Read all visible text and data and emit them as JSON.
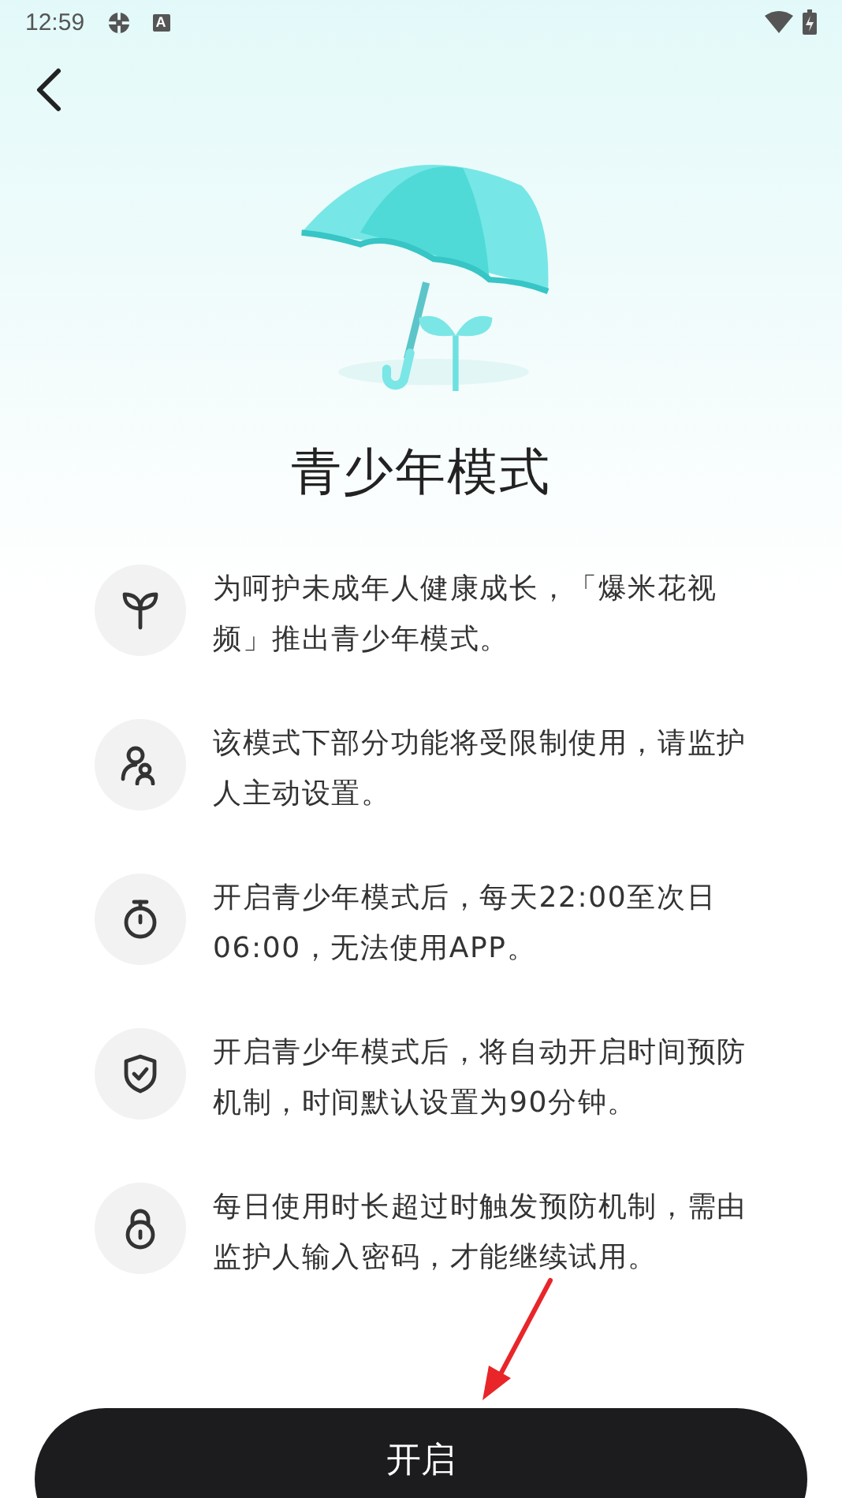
{
  "status_bar": {
    "time": "12:59",
    "app_badge": "A"
  },
  "title": "青少年模式",
  "features": [
    {
      "kind": "sprout",
      "text": "为呵护未成年人健康成长，「爆米花视频」推出青少年模式。"
    },
    {
      "kind": "guardian",
      "text": "该模式下部分功能将受限制使用，请监护人主动设置。"
    },
    {
      "kind": "timer",
      "text": "开启青少年模式后，每天22:00至次日06:00，无法使用APP。"
    },
    {
      "kind": "shield",
      "text": "开启青少年模式后，将自动开启时间预防机制，时间默认设置为90分钟。"
    },
    {
      "kind": "lock",
      "text": "每日使用时长超过时触发预防机制，需由监护人输入密码，才能继续试用。"
    }
  ],
  "button": "开启"
}
